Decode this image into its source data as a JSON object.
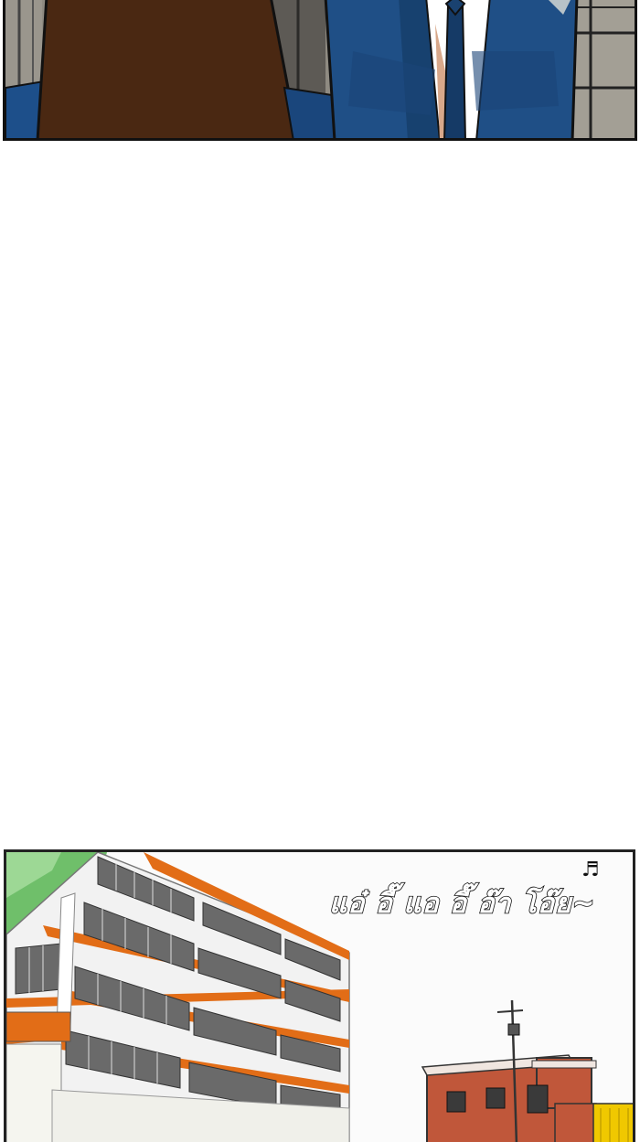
{
  "panels": [
    {
      "name": "office-scene"
    },
    {
      "name": "school-building-scene"
    }
  ],
  "sfx": {
    "text": "แอ๋ อี๊ แอ อี๊ อ๊า โอ๊ย~",
    "note_symbol": "♬"
  },
  "colors": {
    "suit_navy": "#1f4f86",
    "brown_coat": "#4a2812",
    "building_orange": "#e26d17",
    "brick": "#c0573a"
  }
}
